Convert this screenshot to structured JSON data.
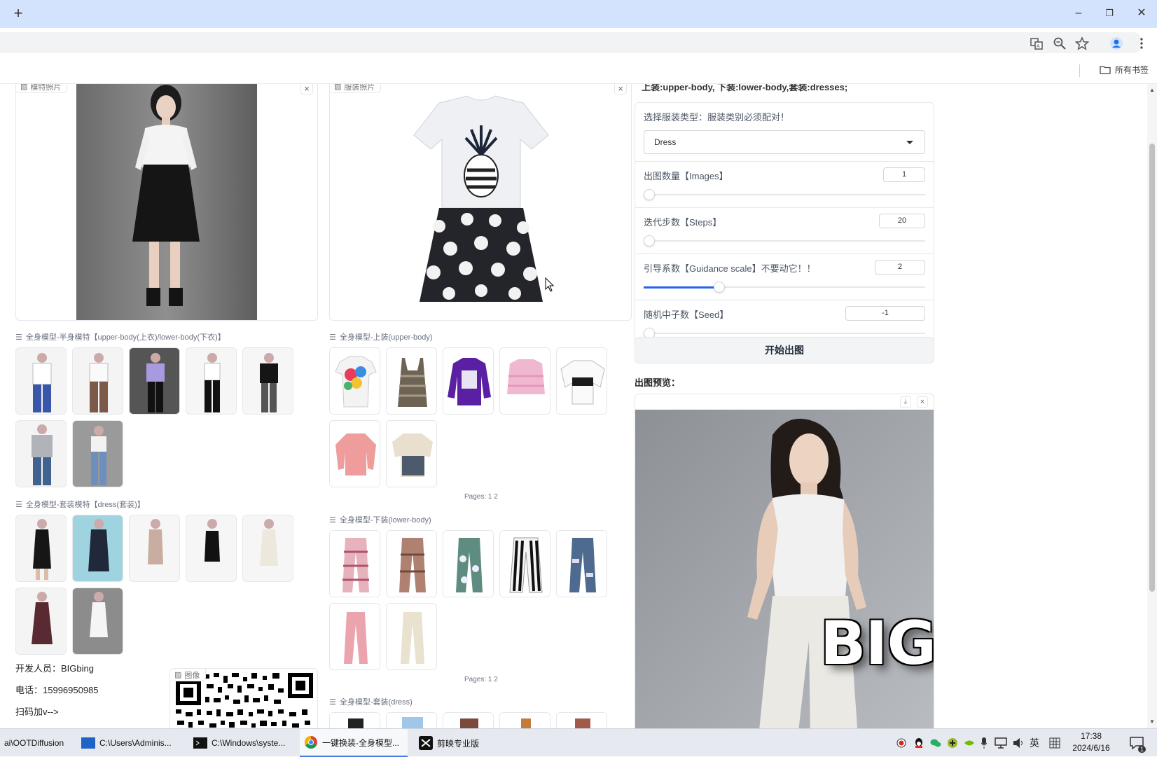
{
  "browser": {
    "new_tab": "+",
    "window_controls": {
      "minimize": "–",
      "restore": "❐",
      "close": "✕"
    },
    "toolbar_icons": [
      "translate-icon",
      "zoom-icon",
      "star-icon",
      "profile-icon",
      "menu-icon"
    ],
    "bookmarks_folder": "所有书签"
  },
  "left": {
    "model_photo_label": "模特照片",
    "garment_photo_label": "服装照片",
    "gallery1": {
      "label": "全身模型-半身模特【upper-body(上衣)/lower-body(下衣)】"
    },
    "gallery2": {
      "label": "全身模型-上装(upper-body)",
      "pages": "Pages: 1 2"
    },
    "gallery3": {
      "label": "全身模型-套装模特【dress(套装)】"
    },
    "gallery4": {
      "label": "全身模型-下装(lower-body)",
      "pages": "Pages: 1 2"
    },
    "gallery5": {
      "label": "全身模型-套装(dress)"
    },
    "developer": "开发人员：BIGbing",
    "phone": "电话：15996950985",
    "scan": "扫码加v-->",
    "qr_label": "图像"
  },
  "right": {
    "top_note": "上装:upper-body, 下装:lower-body,套装:dresses;",
    "category": {
      "label": "选择服装类型：服装类别必须配对！",
      "value": "Dress"
    },
    "images": {
      "label": "出图数量【Images】",
      "value": "1",
      "fraction": 0
    },
    "steps": {
      "label": "迭代步数【Steps】",
      "value": "20",
      "fraction": 0
    },
    "guidance": {
      "label": "引导系数【Guidance scale】不要动它！！",
      "value": "2",
      "fraction": 0.26
    },
    "seed": {
      "label": "随机中子数【Seed】",
      "value": "-1",
      "fraction": 0
    },
    "generate": "开始出图",
    "preview_label": "出图预览：",
    "watermark": "BIGbing"
  },
  "taskbar": {
    "items": [
      "ai\\OOTDiffusion",
      "C:\\Users\\Adminis...",
      "C:\\Windows\\syste...",
      "一键换装-全身模型...",
      "剪映专业版"
    ],
    "ime": "英",
    "time": "17:38",
    "date": "2024/6/16",
    "notif_count": "1"
  },
  "colors": {
    "accent": "#2563eb",
    "titlebar": "#d3e3fd"
  }
}
